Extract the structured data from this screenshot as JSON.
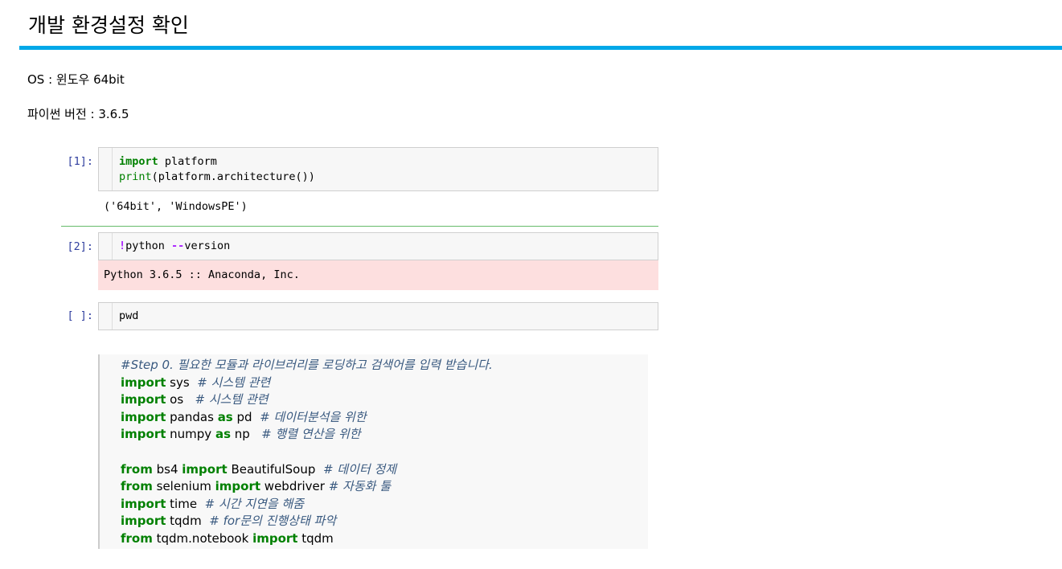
{
  "page": {
    "title": "개발 환경설정 확인",
    "os_line": "OS : 윈도우 64bit",
    "python_line": "파이썬 버전 : 3.6.5"
  },
  "cells": [
    {
      "prompt": "[1]:",
      "code_lines": [
        [
          {
            "t": "import",
            "c": "kw"
          },
          {
            "t": " platform",
            "c": ""
          }
        ],
        [
          {
            "t": "print",
            "c": "bi"
          },
          {
            "t": "(platform.architecture())",
            "c": ""
          }
        ]
      ],
      "output": "('64bit', 'WindowsPE')"
    },
    {
      "prompt": "[2]:",
      "code_lines": [
        [
          {
            "t": "!",
            "c": "op"
          },
          {
            "t": "python ",
            "c": ""
          },
          {
            "t": "--",
            "c": "op"
          },
          {
            "t": "version",
            "c": ""
          }
        ]
      ],
      "stderr": "Python 3.6.5 :: Anaconda, Inc."
    },
    {
      "prompt": "[ ]:",
      "code_lines": [
        [
          {
            "t": "pwd",
            "c": ""
          }
        ]
      ]
    }
  ],
  "snippet": {
    "lines": [
      [
        {
          "t": "#Step 0. 필요한 모듈과 라이브러리를 로딩하고 검색어를 입력 받습니다.",
          "c": "cm"
        }
      ],
      [
        {
          "t": "import",
          "c": "kw"
        },
        {
          "t": " sys  ",
          "c": ""
        },
        {
          "t": "# 시스템 관련",
          "c": "cm"
        }
      ],
      [
        {
          "t": "import",
          "c": "kw"
        },
        {
          "t": " os   ",
          "c": ""
        },
        {
          "t": "# 시스템 관련",
          "c": "cm"
        }
      ],
      [
        {
          "t": "import",
          "c": "kw"
        },
        {
          "t": " pandas ",
          "c": ""
        },
        {
          "t": "as",
          "c": "kw"
        },
        {
          "t": " pd  ",
          "c": ""
        },
        {
          "t": "# 데이터분석을 위한",
          "c": "cm"
        }
      ],
      [
        {
          "t": "import",
          "c": "kw"
        },
        {
          "t": " numpy ",
          "c": ""
        },
        {
          "t": "as",
          "c": "kw"
        },
        {
          "t": " np   ",
          "c": ""
        },
        {
          "t": "# 행렬 연산을 위한",
          "c": "cm"
        }
      ],
      [],
      [
        {
          "t": "from",
          "c": "kw"
        },
        {
          "t": " bs4 ",
          "c": ""
        },
        {
          "t": "import",
          "c": "kw"
        },
        {
          "t": " BeautifulSoup  ",
          "c": ""
        },
        {
          "t": "# 데이터 정제",
          "c": "cm"
        }
      ],
      [
        {
          "t": "from",
          "c": "kw"
        },
        {
          "t": " selenium ",
          "c": ""
        },
        {
          "t": "import",
          "c": "kw"
        },
        {
          "t": " webdriver ",
          "c": ""
        },
        {
          "t": "# 자동화 툴",
          "c": "cm"
        }
      ],
      [
        {
          "t": "import",
          "c": "kw"
        },
        {
          "t": " time  ",
          "c": ""
        },
        {
          "t": "# 시간 지연을 해줌",
          "c": "cm"
        }
      ],
      [
        {
          "t": "import",
          "c": "kw"
        },
        {
          "t": " tqdm  ",
          "c": ""
        },
        {
          "t": "# for문의 진행상태 파악",
          "c": "cm"
        }
      ],
      [
        {
          "t": "from",
          "c": "kw"
        },
        {
          "t": " tqdm.notebook ",
          "c": ""
        },
        {
          "t": "import",
          "c": "kw"
        },
        {
          "t": " tqdm",
          "c": ""
        }
      ]
    ]
  }
}
